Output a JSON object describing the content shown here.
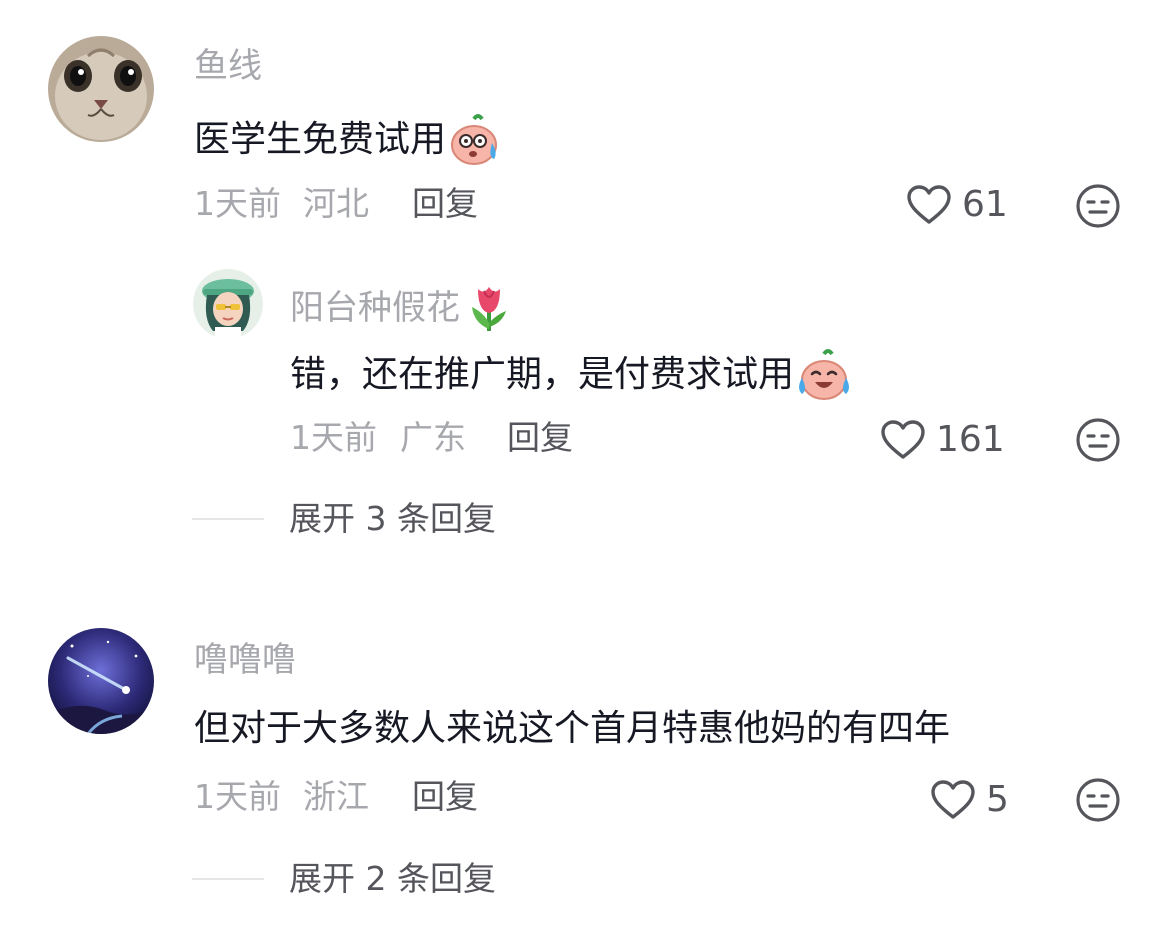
{
  "comments": [
    {
      "username": "鱼线",
      "text": "医学生免费试用",
      "emoji": "sweat-emoji",
      "time": "1天前",
      "location": "河北",
      "reply_label": "回复",
      "likes": "61",
      "replies": [
        {
          "username": "阳台种假花",
          "name_emoji": "tulip-emoji",
          "text": "错，还在推广期，是付费求试用",
          "emoji": "laugh-cry-emoji",
          "time": "1天前",
          "location": "广东",
          "reply_label": "回复",
          "likes": "161"
        }
      ],
      "expand_label": "展开 3 条回复"
    },
    {
      "username": "噜噜噜",
      "text": "但对于大多数人来说这个首月特惠他妈的有四年",
      "time": "1天前",
      "location": "浙江",
      "reply_label": "回复",
      "likes": "5",
      "expand_label": "展开 2 条回复"
    }
  ],
  "icons": {
    "like": "heart-outline-icon",
    "reaction": "meh-face-icon"
  },
  "colors": {
    "primary_text": "#161823",
    "secondary_text": "#a7a8ad",
    "action_text": "#55565c"
  }
}
